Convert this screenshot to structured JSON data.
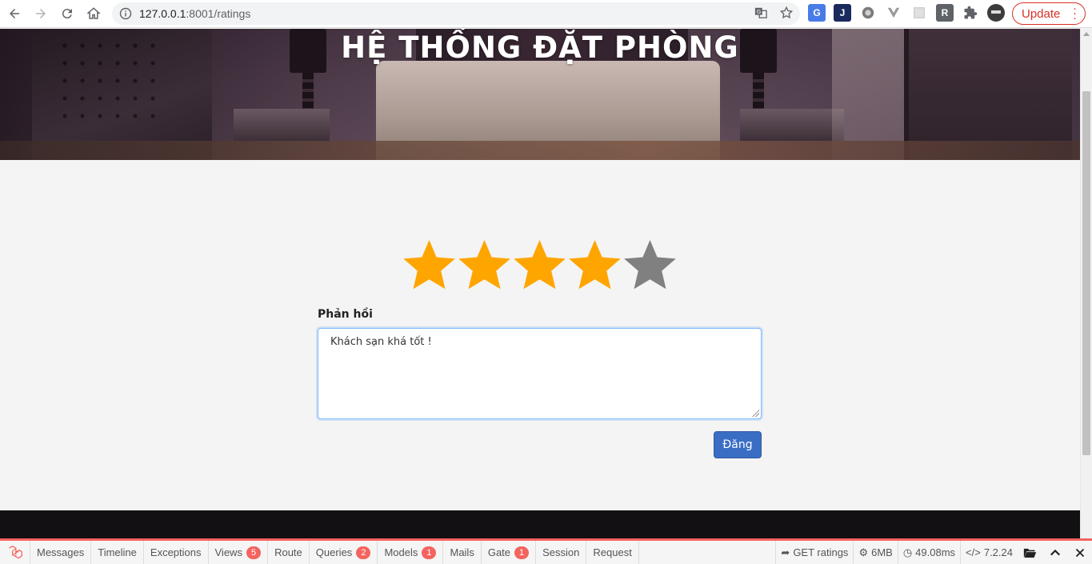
{
  "browser": {
    "url_host": "127.0.0.1",
    "url_rest": ":8001/ratings",
    "update_label": "Update"
  },
  "hero": {
    "title": "HỆ THỐNG ĐẶT PHÒNG"
  },
  "rating": {
    "value": 4,
    "max": 5,
    "filled_color": "#ffa500",
    "empty_color": "#808080"
  },
  "feedback": {
    "label": "Phản hồi",
    "value": "Khách sạn khá tốt !"
  },
  "submit_label": "Đăng",
  "debugbar": {
    "tabs": [
      {
        "label": "Messages",
        "badge": ""
      },
      {
        "label": "Timeline",
        "badge": ""
      },
      {
        "label": "Exceptions",
        "badge": ""
      },
      {
        "label": "Views",
        "badge": "5"
      },
      {
        "label": "Route",
        "badge": ""
      },
      {
        "label": "Queries",
        "badge": "2"
      },
      {
        "label": "Models",
        "badge": "1"
      },
      {
        "label": "Mails",
        "badge": ""
      },
      {
        "label": "Gate",
        "badge": "1"
      },
      {
        "label": "Session",
        "badge": ""
      },
      {
        "label": "Request",
        "badge": ""
      }
    ],
    "request": "GET ratings",
    "memory": "6MB",
    "time": "49.08ms",
    "php_version": "7.2.24",
    "accent_color": "#f4645f"
  }
}
